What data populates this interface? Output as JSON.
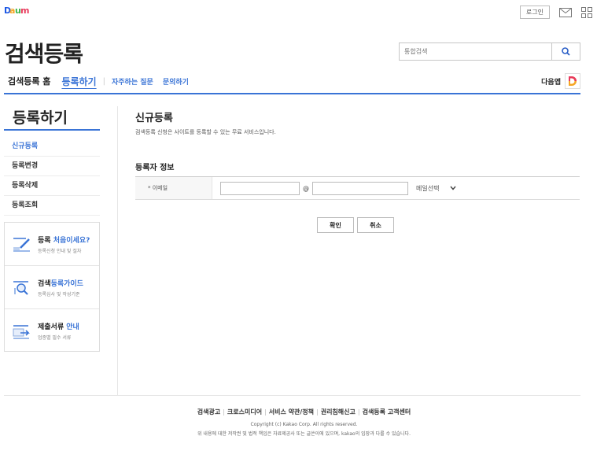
{
  "top": {
    "logo": "Daum",
    "login_label": "로그인",
    "icons": [
      "mail-icon",
      "app-grid-icon"
    ]
  },
  "header": {
    "site_title": "검색등록",
    "search_placeholder": "통합검색",
    "accent_color": "#3a74d6"
  },
  "gnb": {
    "home": "검색등록 홈",
    "active": "등록하기",
    "links": [
      "자주하는 질문",
      "문의하기"
    ],
    "daum_app": "다음앱"
  },
  "sidebar": {
    "title": "등록하기",
    "items": [
      "신규등록",
      "등록변경",
      "등록삭제",
      "등록조회"
    ],
    "guides": [
      {
        "title_plain": "등록 ",
        "title_hl": "처음이세요?",
        "desc": "등록신청 안내 및 절차"
      },
      {
        "title_plain": "검색",
        "title_hl": "등록가이드",
        "desc": "등록심사 및 작성기준"
      },
      {
        "title_plain": "제출서류 ",
        "title_hl": "안내",
        "desc": "업종별 필수 서류"
      }
    ]
  },
  "content": {
    "title": "신규등록",
    "desc": "검색등록 신청은 사이트를 등록할 수 있는 무료 서비스입니다.",
    "section_title": "등록자 정보",
    "email_label": "* 이메일",
    "at": "@",
    "email_select": "메일선택",
    "confirm": "확인",
    "cancel": "취소"
  },
  "footer": {
    "links": [
      "검색광고",
      "크로스미디어",
      "서비스 약관/정책",
      "권리침해신고",
      "검색등록 고객센터"
    ],
    "copyright": "Copyright (c) Kakao Corp. All rights reserved.",
    "note": "위 내용에 대한 저작권 및 법적 책임은 자료제공사 또는 글쓴이에 있으며, kakao의 입장과 다를 수 있습니다."
  }
}
